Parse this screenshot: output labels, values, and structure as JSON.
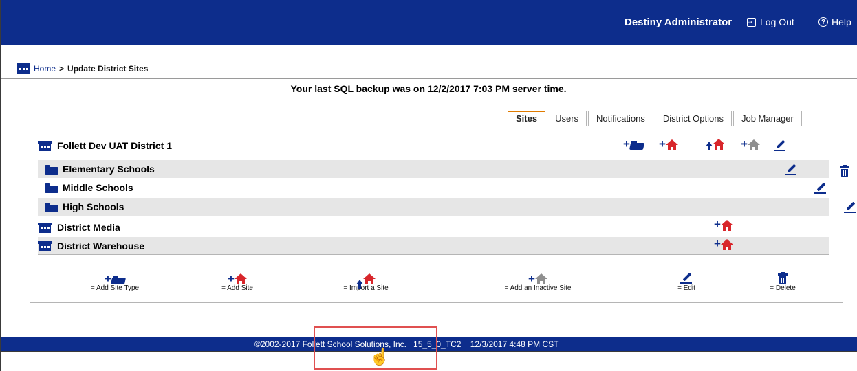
{
  "header": {
    "user_name": "Destiny Administrator",
    "logout_label": "Log Out",
    "help_label": "Help"
  },
  "breadcrumb": {
    "home": "Home",
    "separator": ">",
    "current": "Update District Sites"
  },
  "backup_message": "Your last SQL backup was on 12/2/2017 7:03 PM server time.",
  "tabs": [
    {
      "label": "Sites",
      "active": true
    },
    {
      "label": "Users",
      "active": false
    },
    {
      "label": "Notifications",
      "active": false
    },
    {
      "label": "District Options",
      "active": false
    },
    {
      "label": "Job Manager",
      "active": false
    }
  ],
  "district": {
    "name": "Follett Dev UAT District 1"
  },
  "site_types": [
    {
      "label": "Elementary Schools"
    },
    {
      "label": "Middle Schools"
    },
    {
      "label": "High Schools"
    }
  ],
  "sites": [
    {
      "label": "District Media"
    },
    {
      "label": "District Warehouse"
    }
  ],
  "legend": {
    "add_site_type": "= Add Site Type",
    "add_site": "= Add Site",
    "import_site": "= Import a Site",
    "add_inactive_site": "= Add an Inactive Site",
    "edit": "= Edit",
    "delete": "= Delete"
  },
  "footer": {
    "copyright": "©2002-2017",
    "company_link": "Follett School Solutions, Inc.",
    "version": "15_5_0_TC2",
    "timestamp": "12/3/2017 4:48 PM CST"
  },
  "colors": {
    "brand_blue": "#0d2d8c",
    "house_red": "#d8262b",
    "inactive_gray": "#8f8f8f",
    "tab_accent": "#e07b00",
    "highlight_box": "#e05050"
  }
}
